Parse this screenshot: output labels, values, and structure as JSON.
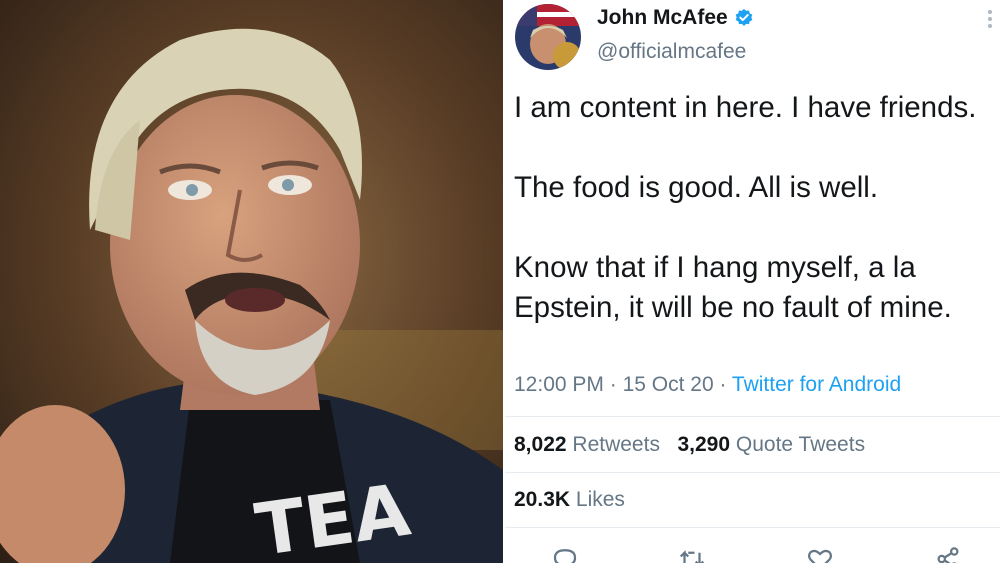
{
  "author": {
    "name": "John McAfee",
    "handle": "@officialmcafee",
    "verified": true
  },
  "tweet": {
    "paragraphs": [
      "I am content in here. I have friends.",
      "The food is good. All is well.",
      "Know that if I hang myself, a la Epstein, it will be no fault of mine."
    ],
    "time": "12:00 PM",
    "date": "15 Oct 20",
    "source": "Twitter for Android"
  },
  "stats": {
    "retweets_count": "8,022",
    "retweets_label": "Retweets",
    "quotes_count": "3,290",
    "quotes_label": "Quote Tweets",
    "likes_count": "20.3K",
    "likes_label": "Likes"
  },
  "icons": [
    "more-icon",
    "verified-icon",
    "reply-icon",
    "retweet-icon",
    "like-icon",
    "share-icon"
  ],
  "colors": {
    "accent": "#1da1f2",
    "text": "#14171a",
    "muted": "#657786",
    "border": "#e6ecf0"
  }
}
